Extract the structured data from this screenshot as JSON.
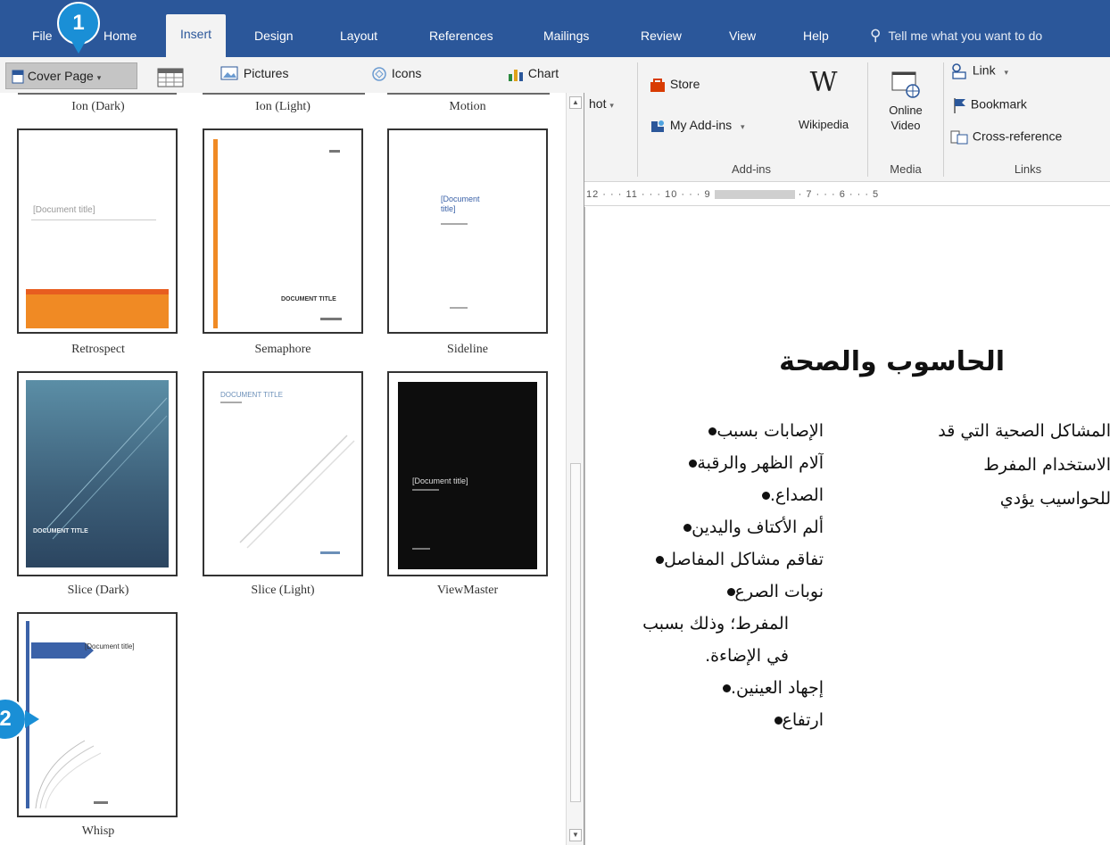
{
  "tabs": {
    "file": "File",
    "home": "Home",
    "insert": "Insert",
    "design": "Design",
    "layout": "Layout",
    "references": "References",
    "mailings": "Mailings",
    "review": "Review",
    "view": "View",
    "help": "Help"
  },
  "tell_me": {
    "glyph": "⚲",
    "text": "Tell me what you want to do"
  },
  "ribbon": {
    "cover_page": "Cover Page",
    "pictures": "Pictures",
    "icons": "Icons",
    "chart": "Chart",
    "screenshot_partial": "hot",
    "store": "Store",
    "my_addins": "My Add-ins",
    "wikipedia_glyph": "W",
    "wikipedia": "Wikipedia",
    "online_video_1": "Online",
    "online_video_2": "Video",
    "link": "Link",
    "bookmark": "Bookmark",
    "cross_reference": "Cross-reference",
    "groups": {
      "addins": "Add-ins",
      "media": "Media",
      "links": "Links"
    }
  },
  "ruler": {
    "left": "12 · · · 11 · · · 10 · · · 9",
    "right": "· 7 · · · 6 · · · 5"
  },
  "gallery": {
    "top_captions": [
      "Ion (Dark)",
      "Ion (Light)",
      "Motion"
    ],
    "items": [
      {
        "caption": "Retrospect",
        "title": "[Document title]"
      },
      {
        "caption": "Semaphore",
        "title": "DOCUMENT TITLE"
      },
      {
        "caption": "Sideline",
        "title": "[Document title]"
      },
      {
        "caption": "Slice (Dark)",
        "title": "DOCUMENT TITLE"
      },
      {
        "caption": "Slice (Light)",
        "title": "DOCUMENT TITLE"
      },
      {
        "caption": "ViewMaster",
        "title": "[Document title]"
      },
      {
        "caption": "Whisp",
        "title": "[Document title]"
      }
    ]
  },
  "document": {
    "title": "الحاسوب والصحة",
    "bullets": [
      "الإصابات بسبب",
      "آلام الظهر والرقبة",
      "الصداع.",
      "ألم الأكتاف واليدين",
      "تفاقم مشاكل المفاصل",
      "نوبات الصرع",
      "المفرط؛ وذلك بسبب",
      "في الإضاءة.",
      "إجهاد العينين.",
      "ارتفاع"
    ],
    "paragraph": [
      "المشاكل الصحية التي قد",
      "الاستخدام المفرط",
      "للحواسيب يؤدي"
    ]
  },
  "callouts": {
    "one": "1",
    "two": "2"
  },
  "colors": {
    "ribbon_blue": "#2b579a",
    "callout": "#1a8fd6",
    "retrospect_band": "#f08a24"
  }
}
